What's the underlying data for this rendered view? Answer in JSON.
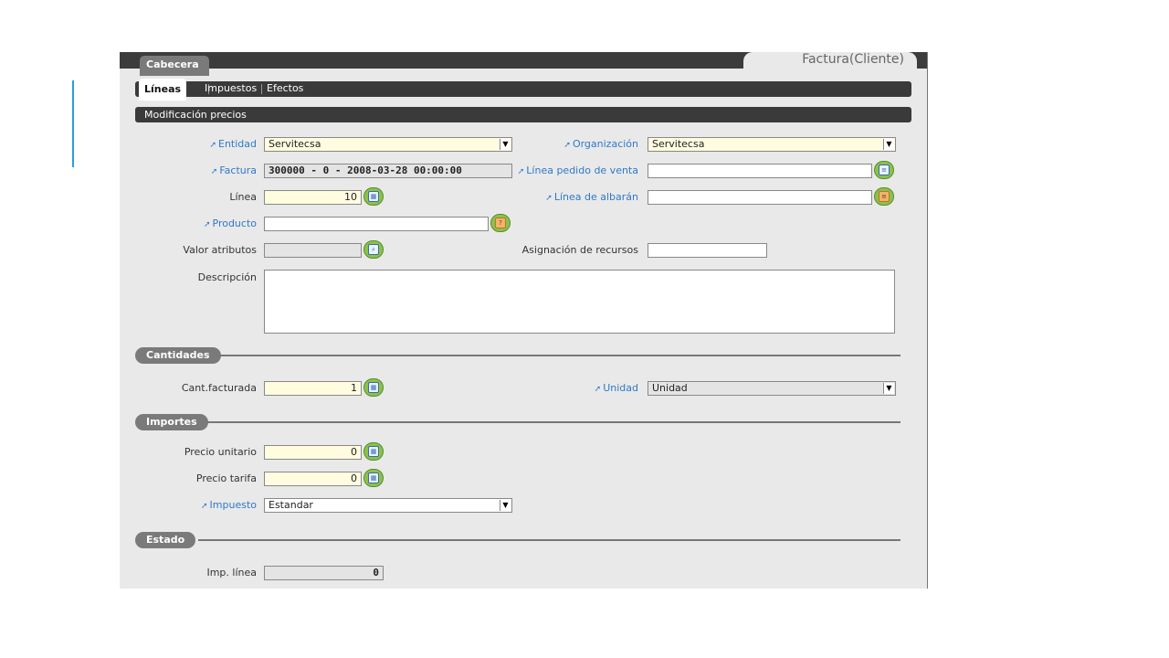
{
  "header": {
    "tab_cabecera": "Cabecera",
    "tab_factura": "Factura(Cliente)"
  },
  "subtabs": {
    "lineas": "Líneas",
    "impuestos": "Impuestos",
    "efectos": "Efectos"
  },
  "modbar": "Modificación precios",
  "form": {
    "entidad": {
      "label": "Entidad",
      "value": "Servitecsa"
    },
    "organizacion": {
      "label": "Organización",
      "value": "Servitecsa"
    },
    "factura": {
      "label": "Factura",
      "value": "300000 - 0 - 2008-03-28 00:00:00"
    },
    "linea_pedido": {
      "label": "Línea pedido de venta",
      "value": ""
    },
    "linea": {
      "label": "Línea",
      "value": "10"
    },
    "linea_albaran": {
      "label": "Línea de albarán",
      "value": ""
    },
    "producto": {
      "label": "Producto",
      "value": ""
    },
    "valor_atributos": {
      "label": "Valor atributos",
      "value": ""
    },
    "asignacion": {
      "label": "Asignación de recursos",
      "value": ""
    },
    "descripcion": {
      "label": "Descripción",
      "value": ""
    }
  },
  "sections": {
    "cantidades": "Cantidades",
    "importes": "Importes",
    "estado": "Estado"
  },
  "cantidades": {
    "cant_facturada": {
      "label": "Cant.facturada",
      "value": "1"
    },
    "unidad": {
      "label": "Unidad",
      "value": "Unidad"
    }
  },
  "importes": {
    "precio_unitario": {
      "label": "Precio unitario",
      "value": "0"
    },
    "precio_tarifa": {
      "label": "Precio tarifa",
      "value": "0"
    },
    "impuesto": {
      "label": "Impuesto",
      "value": "Estandar"
    }
  },
  "estado": {
    "imp_linea": {
      "label": "Imp. línea",
      "value": "0"
    }
  },
  "icons": {
    "calculator": "calculator-icon",
    "search": "search-icon",
    "dropdown": "chevron-down-icon",
    "link_arrow": "arrow-link-icon"
  },
  "colors": {
    "mandatory_field": "#fffce0",
    "link_label": "#2f79c9",
    "bar": "#3a3a3a"
  }
}
